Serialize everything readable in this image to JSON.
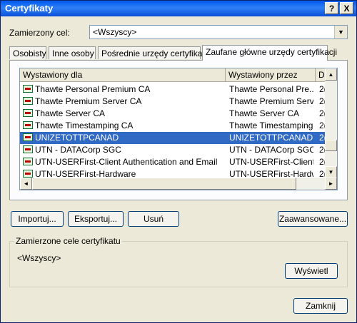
{
  "window": {
    "title": "Certyfikaty",
    "help_label": "?",
    "close_label": "X"
  },
  "purpose": {
    "label": "Zamierzony cel:",
    "selected": "<Wszyscy>"
  },
  "tabs": [
    {
      "label": "Osobisty"
    },
    {
      "label": "Inne osoby"
    },
    {
      "label": "Pośrednie urzędy certyfikacji"
    },
    {
      "label": "Zaufane główne urzędy certyfikacji"
    }
  ],
  "list": {
    "headers": [
      "Wystawiony dla",
      "Wystawiony przez",
      "D"
    ],
    "rows": [
      {
        "issued_to": "Thawte Personal Premium CA",
        "issued_by": "Thawte Personal Pre...",
        "date": "2("
      },
      {
        "issued_to": "Thawte Premium Server CA",
        "issued_by": "Thawte Premium Serv...",
        "date": "2("
      },
      {
        "issued_to": "Thawte Server CA",
        "issued_by": "Thawte Server CA",
        "date": "2("
      },
      {
        "issued_to": "Thawte Timestamping CA",
        "issued_by": "Thawte Timestamping...",
        "date": "2("
      },
      {
        "issued_to": "UNIZETOTTPCANAD",
        "issued_by": "UNIZETOTTPCANAD",
        "date": "2("
      },
      {
        "issued_to": "UTN - DATACorp SGC",
        "issued_by": "UTN - DATACorp SGC",
        "date": "2("
      },
      {
        "issued_to": "UTN-USERFirst-Client Authentication and Email",
        "issued_by": "UTN-USERFirst-Client ...",
        "date": "2("
      },
      {
        "issued_to": "UTN-USERFirst-Hardware",
        "issued_by": "UTN-USERFirst-Hardw...",
        "date": "2("
      }
    ]
  },
  "buttons": {
    "import": "Importuj...",
    "export": "Eksportuj...",
    "remove": "Usuń",
    "advanced": "Zaawansowane...",
    "view": "Wyświetl",
    "close": "Zamknij"
  },
  "purposes_group": {
    "label": "Zamierzone cele certyfikatu",
    "value": "<Wszyscy>"
  }
}
